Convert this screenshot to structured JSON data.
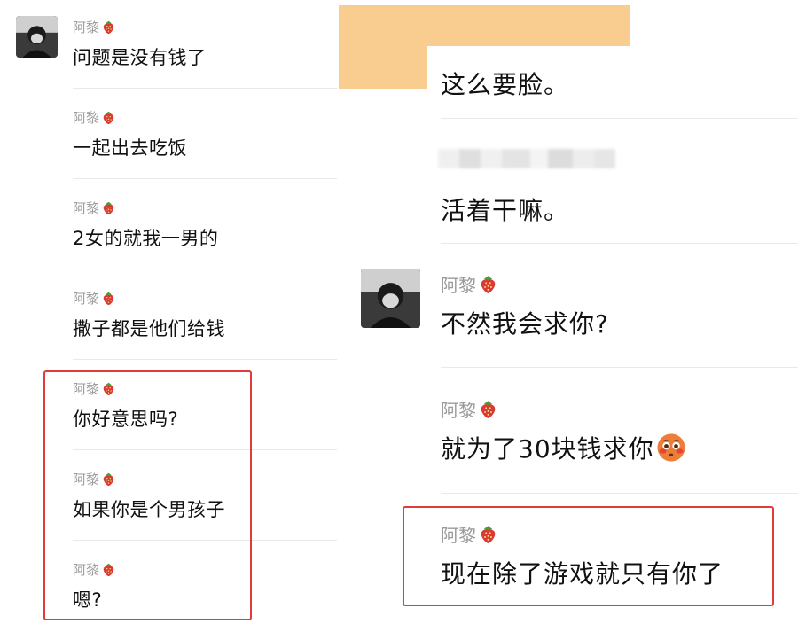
{
  "sender_name": "阿黎",
  "left_messages": [
    {
      "text": "问题是没有钱了"
    },
    {
      "text": "一起出去吃饭"
    },
    {
      "text": "2女的就我一男的"
    },
    {
      "text": "撒子都是他们给钱"
    },
    {
      "text": "你好意思吗?"
    },
    {
      "text": "如果你是个男孩子"
    },
    {
      "text": "嗯?"
    }
  ],
  "right_top_messages": [
    {
      "text": "这么要脸。"
    },
    {
      "text": "活着干嘛。"
    }
  ],
  "right_messages": [
    {
      "text": "不然我会求你?"
    },
    {
      "text": "就为了30块钱求你"
    },
    {
      "text": "现在除了游戏就只有你了"
    }
  ],
  "icons": {
    "name_badge": "strawberry-icon",
    "reaction": "flushed-face-emoji"
  },
  "colors": {
    "highlight": "#e23b3b",
    "overlay": "#f9cd8f",
    "sender_name": "#9a9a9a"
  }
}
